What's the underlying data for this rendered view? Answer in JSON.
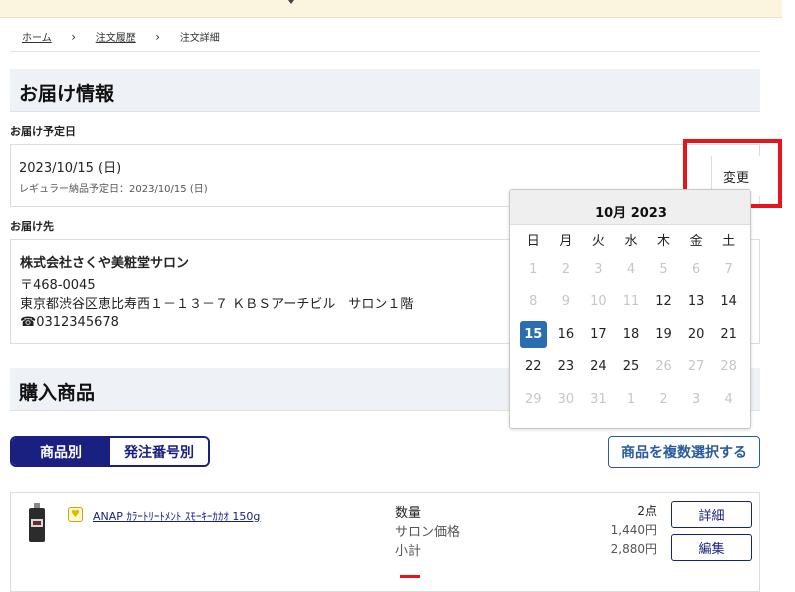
{
  "breadcrumb": {
    "home": "ホーム",
    "history": "注文履歴",
    "detail": "注文詳細"
  },
  "delivery": {
    "heading": "お届け情報",
    "date_label": "お届け予定日",
    "date_value": "2023/10/15 (日)",
    "regular_note": "レギュラー納品予定日：2023/10/15 (日)",
    "change_label": "変更",
    "address_label": "お届け先",
    "company": "株式会社さくや美粧堂サロン",
    "postal": "〒468-0045",
    "address": "東京都渋谷区恵比寿西１－１３－７ ＫＢＳアーチビル　サロン１階",
    "phone": "☎0312345678"
  },
  "purchase": {
    "heading": "購入商品",
    "tab_by_item": "商品別",
    "tab_by_order": "発注番号別",
    "multi_select": "商品を複数選択する",
    "product": {
      "name": "ANAP ｶﾗｰﾄﾘｰﾄﾒﾝﾄ ｽﾓｰｷｰｶｶｵ 150g",
      "qty_label": "数量",
      "qty_value": "2点",
      "price_label": "サロン価格",
      "price_value": "1,440円",
      "subtotal_label": "小計",
      "subtotal_value": "2,880円",
      "detail_button": "詳細",
      "edit_button": "編集"
    }
  },
  "calendar": {
    "title": "10月 2023",
    "weekdays": [
      "日",
      "月",
      "火",
      "水",
      "木",
      "金",
      "土"
    ],
    "selected": "15",
    "days": [
      {
        "d": "1",
        "disabled": true
      },
      {
        "d": "2",
        "disabled": true
      },
      {
        "d": "3",
        "disabled": true
      },
      {
        "d": "4",
        "disabled": true
      },
      {
        "d": "5",
        "disabled": true
      },
      {
        "d": "6",
        "disabled": true
      },
      {
        "d": "7",
        "disabled": true
      },
      {
        "d": "8",
        "disabled": true
      },
      {
        "d": "9",
        "disabled": true
      },
      {
        "d": "10",
        "disabled": true
      },
      {
        "d": "11",
        "disabled": true
      },
      {
        "d": "12",
        "disabled": false
      },
      {
        "d": "13",
        "disabled": false
      },
      {
        "d": "14",
        "disabled": false
      },
      {
        "d": "15",
        "disabled": false
      },
      {
        "d": "16",
        "disabled": false
      },
      {
        "d": "17",
        "disabled": false
      },
      {
        "d": "18",
        "disabled": false
      },
      {
        "d": "19",
        "disabled": false
      },
      {
        "d": "20",
        "disabled": false
      },
      {
        "d": "21",
        "disabled": false
      },
      {
        "d": "22",
        "disabled": false
      },
      {
        "d": "23",
        "disabled": false
      },
      {
        "d": "24",
        "disabled": false
      },
      {
        "d": "25",
        "disabled": false
      },
      {
        "d": "26",
        "disabled": true
      },
      {
        "d": "27",
        "disabled": true
      },
      {
        "d": "28",
        "disabled": true
      },
      {
        "d": "29",
        "disabled": true
      },
      {
        "d": "30",
        "disabled": true
      },
      {
        "d": "31",
        "disabled": true
      },
      {
        "d": "1",
        "disabled": true
      },
      {
        "d": "2",
        "disabled": true
      },
      {
        "d": "3",
        "disabled": true
      },
      {
        "d": "4",
        "disabled": true
      }
    ]
  },
  "colors": {
    "accent": "#1a2080",
    "selected_day": "#2a6db0",
    "highlight_box": "#e8141b",
    "topbar": "#fbf4df"
  }
}
